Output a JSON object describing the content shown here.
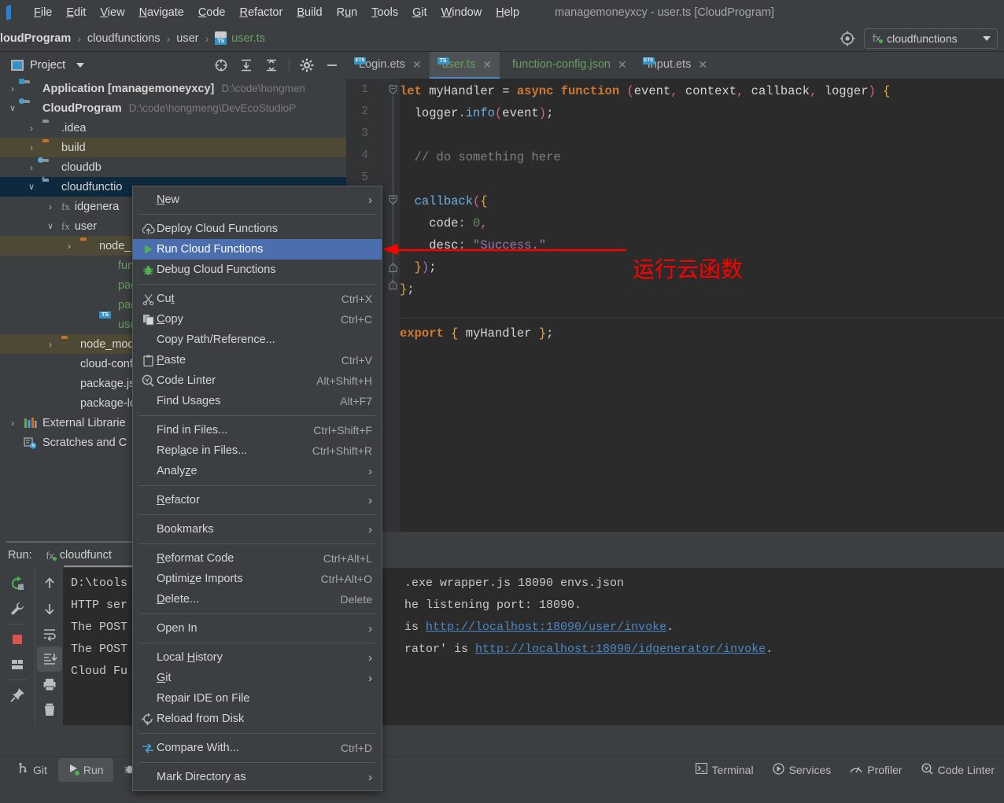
{
  "window": {
    "title": "managemoneyxcy - user.ts [CloudProgram]"
  },
  "menubar": {
    "items": [
      {
        "label": "File",
        "mnemonic": "F"
      },
      {
        "label": "Edit",
        "mnemonic": "E"
      },
      {
        "label": "View",
        "mnemonic": "V"
      },
      {
        "label": "Navigate",
        "mnemonic": "N"
      },
      {
        "label": "Code",
        "mnemonic": "C"
      },
      {
        "label": "Refactor",
        "mnemonic": "R"
      },
      {
        "label": "Build",
        "mnemonic": "B"
      },
      {
        "label": "Run",
        "mnemonic": "u"
      },
      {
        "label": "Tools",
        "mnemonic": "T"
      },
      {
        "label": "Git",
        "mnemonic": "G"
      },
      {
        "label": "Window",
        "mnemonic": "W"
      },
      {
        "label": "Help",
        "mnemonic": "H"
      }
    ]
  },
  "breadcrumb": {
    "items": [
      "loudProgram",
      "cloudfunctions",
      "user",
      "user.ts"
    ],
    "separator": "›"
  },
  "run_config_selector": {
    "fx": "fx",
    "label": "cloudfunctions"
  },
  "project_panel": {
    "title": "Project",
    "tree": [
      {
        "indent": 0,
        "arrow": "›",
        "icon": "folder-module",
        "label": "Application [managemoneyxcy]",
        "bold": true,
        "path": "D:\\code\\hongmen",
        "state": "normal"
      },
      {
        "indent": 0,
        "arrow": "∨",
        "icon": "folder-cloud",
        "label": "CloudProgram",
        "bold": true,
        "path": "D:\\code\\hongmeng\\DevEcoStudioP",
        "state": "normal"
      },
      {
        "indent": 1,
        "arrow": "›",
        "icon": "folder-grey",
        "label": ".idea",
        "path": "",
        "state": "normal"
      },
      {
        "indent": 1,
        "arrow": "›",
        "icon": "folder-orange",
        "label": "build",
        "path": "",
        "state": "highlight"
      },
      {
        "indent": 1,
        "arrow": "›",
        "icon": "folder-db",
        "label": "clouddb",
        "path": "",
        "state": "normal"
      },
      {
        "indent": 1,
        "arrow": "∨",
        "icon": "folder-fn",
        "label": "cloudfunctio",
        "path": "",
        "state": "selected"
      },
      {
        "indent": 2,
        "arrow": "›",
        "icon": "fx",
        "label": "idgenera",
        "path": "",
        "state": "normal"
      },
      {
        "indent": 2,
        "arrow": "∨",
        "icon": "fx",
        "label": "user",
        "path": "",
        "state": "normal"
      },
      {
        "indent": 3,
        "arrow": "›",
        "icon": "folder-orange",
        "label": "node_",
        "path": "",
        "state": "highlight"
      },
      {
        "indent": 4,
        "arrow": "",
        "icon": "json",
        "label": "functi",
        "path": "",
        "state": "green"
      },
      {
        "indent": 4,
        "arrow": "",
        "icon": "json",
        "label": "packa",
        "path": "",
        "state": "green"
      },
      {
        "indent": 4,
        "arrow": "",
        "icon": "json",
        "label": "packa",
        "path": "",
        "state": "green"
      },
      {
        "indent": 4,
        "arrow": "",
        "icon": "ts",
        "label": "user.t",
        "path": "",
        "state": "green"
      },
      {
        "indent": 2,
        "arrow": "›",
        "icon": "folder-orange",
        "label": "node_modu",
        "path": "",
        "state": "highlight"
      },
      {
        "indent": 2,
        "arrow": "",
        "icon": "json",
        "label": "cloud-config",
        "path": "",
        "state": "normal"
      },
      {
        "indent": 2,
        "arrow": "",
        "icon": "json",
        "label": "package.json",
        "path": "",
        "state": "normal"
      },
      {
        "indent": 2,
        "arrow": "",
        "icon": "json",
        "label": "package-loc",
        "path": "",
        "state": "normal"
      },
      {
        "indent": 0,
        "arrow": "›",
        "icon": "library",
        "label": "External Librarie",
        "path": "",
        "state": "normal"
      },
      {
        "indent": 0,
        "arrow": "",
        "icon": "scratches",
        "label": "Scratches and C",
        "path": "",
        "state": "normal"
      }
    ]
  },
  "editor_tabs": [
    {
      "label": "Login.ets",
      "icon": "ets",
      "active": false,
      "green": false
    },
    {
      "label": "user.ts",
      "icon": "ts",
      "active": true,
      "green": true
    },
    {
      "label": "function-config.json",
      "icon": "json",
      "active": false,
      "green": true
    },
    {
      "label": "Input.ets",
      "icon": "ets",
      "active": false,
      "green": false
    }
  ],
  "editor": {
    "line_numbers": [
      "1",
      "2",
      "3",
      "4",
      "5"
    ],
    "lines": [
      "let myHandler = async function (event, context, callback, logger) {",
      "    logger.info(event);",
      "",
      "    // do something here",
      "",
      "    callback({",
      "      code: 0,",
      "      desc: \"Success.\"",
      "    });",
      "};",
      "",
      "export { myHandler };"
    ]
  },
  "annotation": {
    "text": "运行云函数",
    "color": "#ff0000"
  },
  "context_menu": {
    "groups": [
      {
        "items": [
          {
            "label": "New",
            "mnemonic": "N",
            "accel": "",
            "submenu": true,
            "icon": "",
            "selected": false
          }
        ]
      },
      {
        "items": [
          {
            "label": "Deploy Cloud Functions",
            "accel": "",
            "submenu": false,
            "icon": "cloud-upload-icon",
            "selected": false
          },
          {
            "label": "Run Cloud Functions",
            "accel": "",
            "submenu": false,
            "icon": "run-play-icon",
            "selected": true
          },
          {
            "label": "Debug Cloud Functions",
            "accel": "",
            "submenu": false,
            "icon": "debug-bug-icon",
            "selected": false
          }
        ]
      },
      {
        "items": [
          {
            "label": "Cut",
            "mnemonic": "t",
            "accel": "Ctrl+X",
            "submenu": false,
            "icon": "scissors-icon",
            "selected": false
          },
          {
            "label": "Copy",
            "mnemonic": "C",
            "accel": "Ctrl+C",
            "submenu": false,
            "icon": "copy-icon",
            "selected": false
          },
          {
            "label": "Copy Path/Reference...",
            "accel": "",
            "submenu": false,
            "icon": "",
            "selected": false
          },
          {
            "label": "Paste",
            "mnemonic": "P",
            "accel": "Ctrl+V",
            "submenu": false,
            "icon": "clipboard-icon",
            "selected": false
          },
          {
            "label": "Code Linter",
            "accel": "Alt+Shift+H",
            "submenu": false,
            "icon": "linter-icon",
            "selected": false
          },
          {
            "label": "Find Usages",
            "accel": "Alt+F7",
            "submenu": false,
            "icon": "",
            "selected": false
          }
        ]
      },
      {
        "items": [
          {
            "label": "Find in Files...",
            "accel": "Ctrl+Shift+F",
            "submenu": false,
            "icon": "",
            "selected": false
          },
          {
            "label": "Replace in Files...",
            "mnemonic": "a",
            "accel": "Ctrl+Shift+R",
            "submenu": false,
            "icon": "",
            "selected": false
          },
          {
            "label": "Analyze",
            "mnemonic": "z",
            "accel": "",
            "submenu": true,
            "icon": "",
            "selected": false
          }
        ]
      },
      {
        "items": [
          {
            "label": "Refactor",
            "mnemonic": "R",
            "accel": "",
            "submenu": true,
            "icon": "",
            "selected": false
          }
        ]
      },
      {
        "items": [
          {
            "label": "Bookmarks",
            "accel": "",
            "submenu": true,
            "icon": "",
            "selected": false
          }
        ]
      },
      {
        "items": [
          {
            "label": "Reformat Code",
            "mnemonic": "R",
            "accel": "Ctrl+Alt+L",
            "submenu": false,
            "icon": "",
            "selected": false
          },
          {
            "label": "Optimize Imports",
            "mnemonic": "z",
            "accel": "Ctrl+Alt+O",
            "submenu": false,
            "icon": "",
            "selected": false
          },
          {
            "label": "Delete...",
            "mnemonic": "D",
            "accel": "Delete",
            "submenu": false,
            "icon": "",
            "selected": false
          }
        ]
      },
      {
        "items": [
          {
            "label": "Open In",
            "accel": "",
            "submenu": true,
            "icon": "",
            "selected": false
          }
        ]
      },
      {
        "items": [
          {
            "label": "Local History",
            "mnemonic": "H",
            "accel": "",
            "submenu": true,
            "icon": "",
            "selected": false
          },
          {
            "label": "Git",
            "mnemonic": "G",
            "accel": "",
            "submenu": true,
            "icon": "",
            "selected": false
          },
          {
            "label": "Repair IDE on File",
            "accel": "",
            "submenu": false,
            "icon": "",
            "selected": false
          },
          {
            "label": "Reload from Disk",
            "accel": "",
            "submenu": false,
            "icon": "reload-icon",
            "selected": false
          }
        ]
      },
      {
        "items": [
          {
            "label": "Compare With...",
            "accel": "Ctrl+D",
            "submenu": false,
            "icon": "compare-icon",
            "selected": false
          }
        ]
      },
      {
        "items": [
          {
            "label": "Mark Directory as",
            "accel": "",
            "submenu": true,
            "icon": "",
            "selected": false
          }
        ]
      }
    ]
  },
  "run_panel": {
    "label": "Run:",
    "config_fx": "fx",
    "config_name": "cloudfunct",
    "console_lines": [
      {
        "prefix": "D:\\tools",
        "hidden_mid": "",
        "suffix": ".exe wrapper.js 18090 envs.json"
      },
      {
        "prefix": "HTTP ser",
        "suffix": "he listening port: 18090."
      },
      {
        "prefix": "The POST",
        "suffix_pre": "is ",
        "link": "http://localhost:18090/user/invoke",
        "suffix_post": "."
      },
      {
        "prefix": "The POST",
        "suffix_pre": "rator' is ",
        "link": "http://localhost:18090/idgenerator/invoke",
        "suffix_post": "."
      },
      {
        "prefix": "Cloud Fu",
        "suffix": ""
      }
    ]
  },
  "statusbar": {
    "left_items": [
      {
        "label": "Git",
        "icon": "git-branch-icon",
        "active": false
      },
      {
        "label": "Run",
        "icon": "run-play-icon",
        "active": true
      },
      {
        "label": "",
        "icon": "debug-bug-icon",
        "active": false
      }
    ],
    "right_items": [
      {
        "label": "Terminal",
        "icon": "terminal-icon"
      },
      {
        "label": "Services",
        "icon": "services-icon"
      },
      {
        "label": "Profiler",
        "icon": "profiler-icon"
      },
      {
        "label": "Code Linter",
        "icon": "linter-icon"
      }
    ]
  },
  "colors": {
    "accent": "#4b6eaf",
    "panel_bg": "#3c3f41",
    "editor_bg": "#2b2b2b",
    "selection": "#0d293e",
    "highlight_row": "#4e4935",
    "annotation_red": "#ff0000",
    "link_blue": "#4a88c7",
    "green_file": "#6a9e5e"
  }
}
